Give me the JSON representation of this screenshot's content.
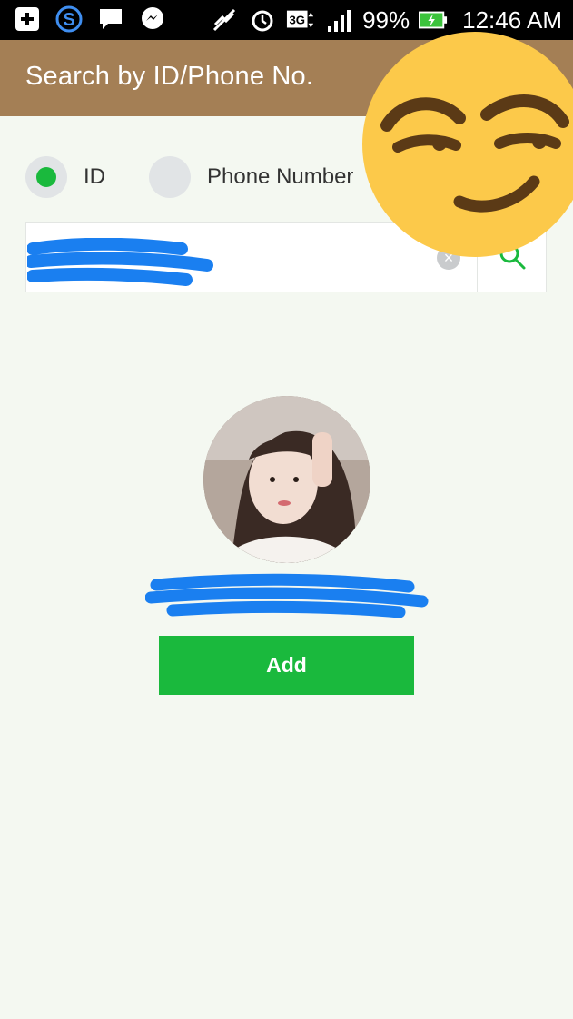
{
  "status_bar": {
    "battery": "99%",
    "time": "12:46 AM",
    "network": "3G",
    "icons": [
      "add-icon",
      "s-app-icon",
      "message-icon",
      "messenger-icon",
      "mute-icon",
      "alarm-icon",
      "network-3g-icon",
      "signal-icon",
      "battery-charging-icon"
    ]
  },
  "header": {
    "title": "Search by ID/Phone No."
  },
  "search_type": {
    "options": [
      {
        "label": "ID",
        "selected": true
      },
      {
        "label": "Phone Number",
        "selected": false
      }
    ]
  },
  "search": {
    "value": ""
  },
  "profile": {
    "add_label": "Add"
  },
  "colors": {
    "header": "#a47f55",
    "accent": "#1ab93d",
    "background": "#f4f8f1",
    "redaction": "#1a7ff0",
    "emoji": "#fcc94a"
  }
}
